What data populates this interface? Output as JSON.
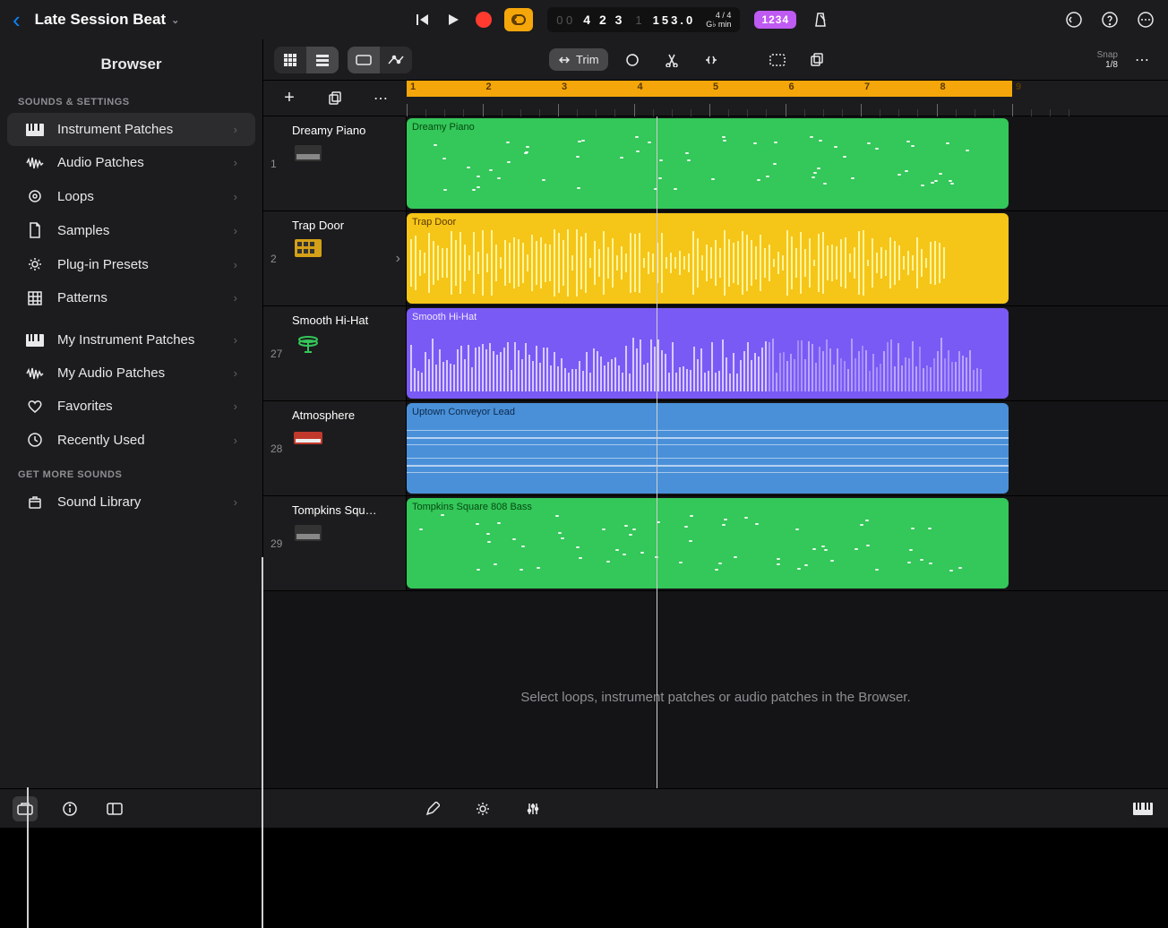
{
  "header": {
    "project_title": "Late Session Beat",
    "lcd": {
      "bars": "4 2 3",
      "beat_ghost": "1",
      "tempo": "153.0",
      "sig_top": "4 / 4",
      "sig_bot": "G♭ min"
    },
    "link_label": "1234"
  },
  "toolbar": {
    "trim_label": "Trim",
    "snap_title": "Snap",
    "snap_value": "1/8"
  },
  "browser": {
    "title": "Browser",
    "section1": "SOUNDS & SETTINGS",
    "items1": [
      {
        "label": "Instrument Patches",
        "icon": "piano-keys-icon",
        "sel": true
      },
      {
        "label": "Audio Patches",
        "icon": "waveform-icon"
      },
      {
        "label": "Loops",
        "icon": "loop-icon"
      },
      {
        "label": "Samples",
        "icon": "file-icon"
      },
      {
        "label": "Plug-in Presets",
        "icon": "gear-sun-icon"
      },
      {
        "label": "Patterns",
        "icon": "grid-icon"
      }
    ],
    "items2": [
      {
        "label": "My Instrument Patches",
        "icon": "piano-keys-icon"
      },
      {
        "label": "My Audio Patches",
        "icon": "waveform-icon"
      },
      {
        "label": "Favorites",
        "icon": "heart-icon"
      },
      {
        "label": "Recently Used",
        "icon": "clock-icon"
      }
    ],
    "section3": "GET MORE SOUNDS",
    "items3": [
      {
        "label": "Sound Library",
        "icon": "box-icon"
      }
    ]
  },
  "ruler": {
    "bars": [
      "1",
      "2",
      "3",
      "4",
      "5",
      "6",
      "7",
      "8",
      "9"
    ],
    "playhead_bar": 4.3
  },
  "tracks": [
    {
      "num": "1",
      "name": "Dreamy Piano",
      "region": "Dreamy Piano",
      "color": "green",
      "icon": "keyboard"
    },
    {
      "num": "2",
      "name": "Trap Door",
      "region": "Trap Door",
      "color": "yellow",
      "icon": "drum-machine"
    },
    {
      "num": "27",
      "name": "Smooth Hi-Hat",
      "region": "Smooth Hi-Hat",
      "color": "purple",
      "icon": "hihat"
    },
    {
      "num": "28",
      "name": "Atmosphere",
      "region": "Uptown Conveyor Lead",
      "color": "blue",
      "icon": "synth"
    },
    {
      "num": "29",
      "name": "Tompkins Squ…",
      "region": "Tompkins Square 808 Bass",
      "color": "green",
      "icon": "keyboard"
    }
  ],
  "hint": "Select loops, instrument patches or audio patches in the Browser."
}
